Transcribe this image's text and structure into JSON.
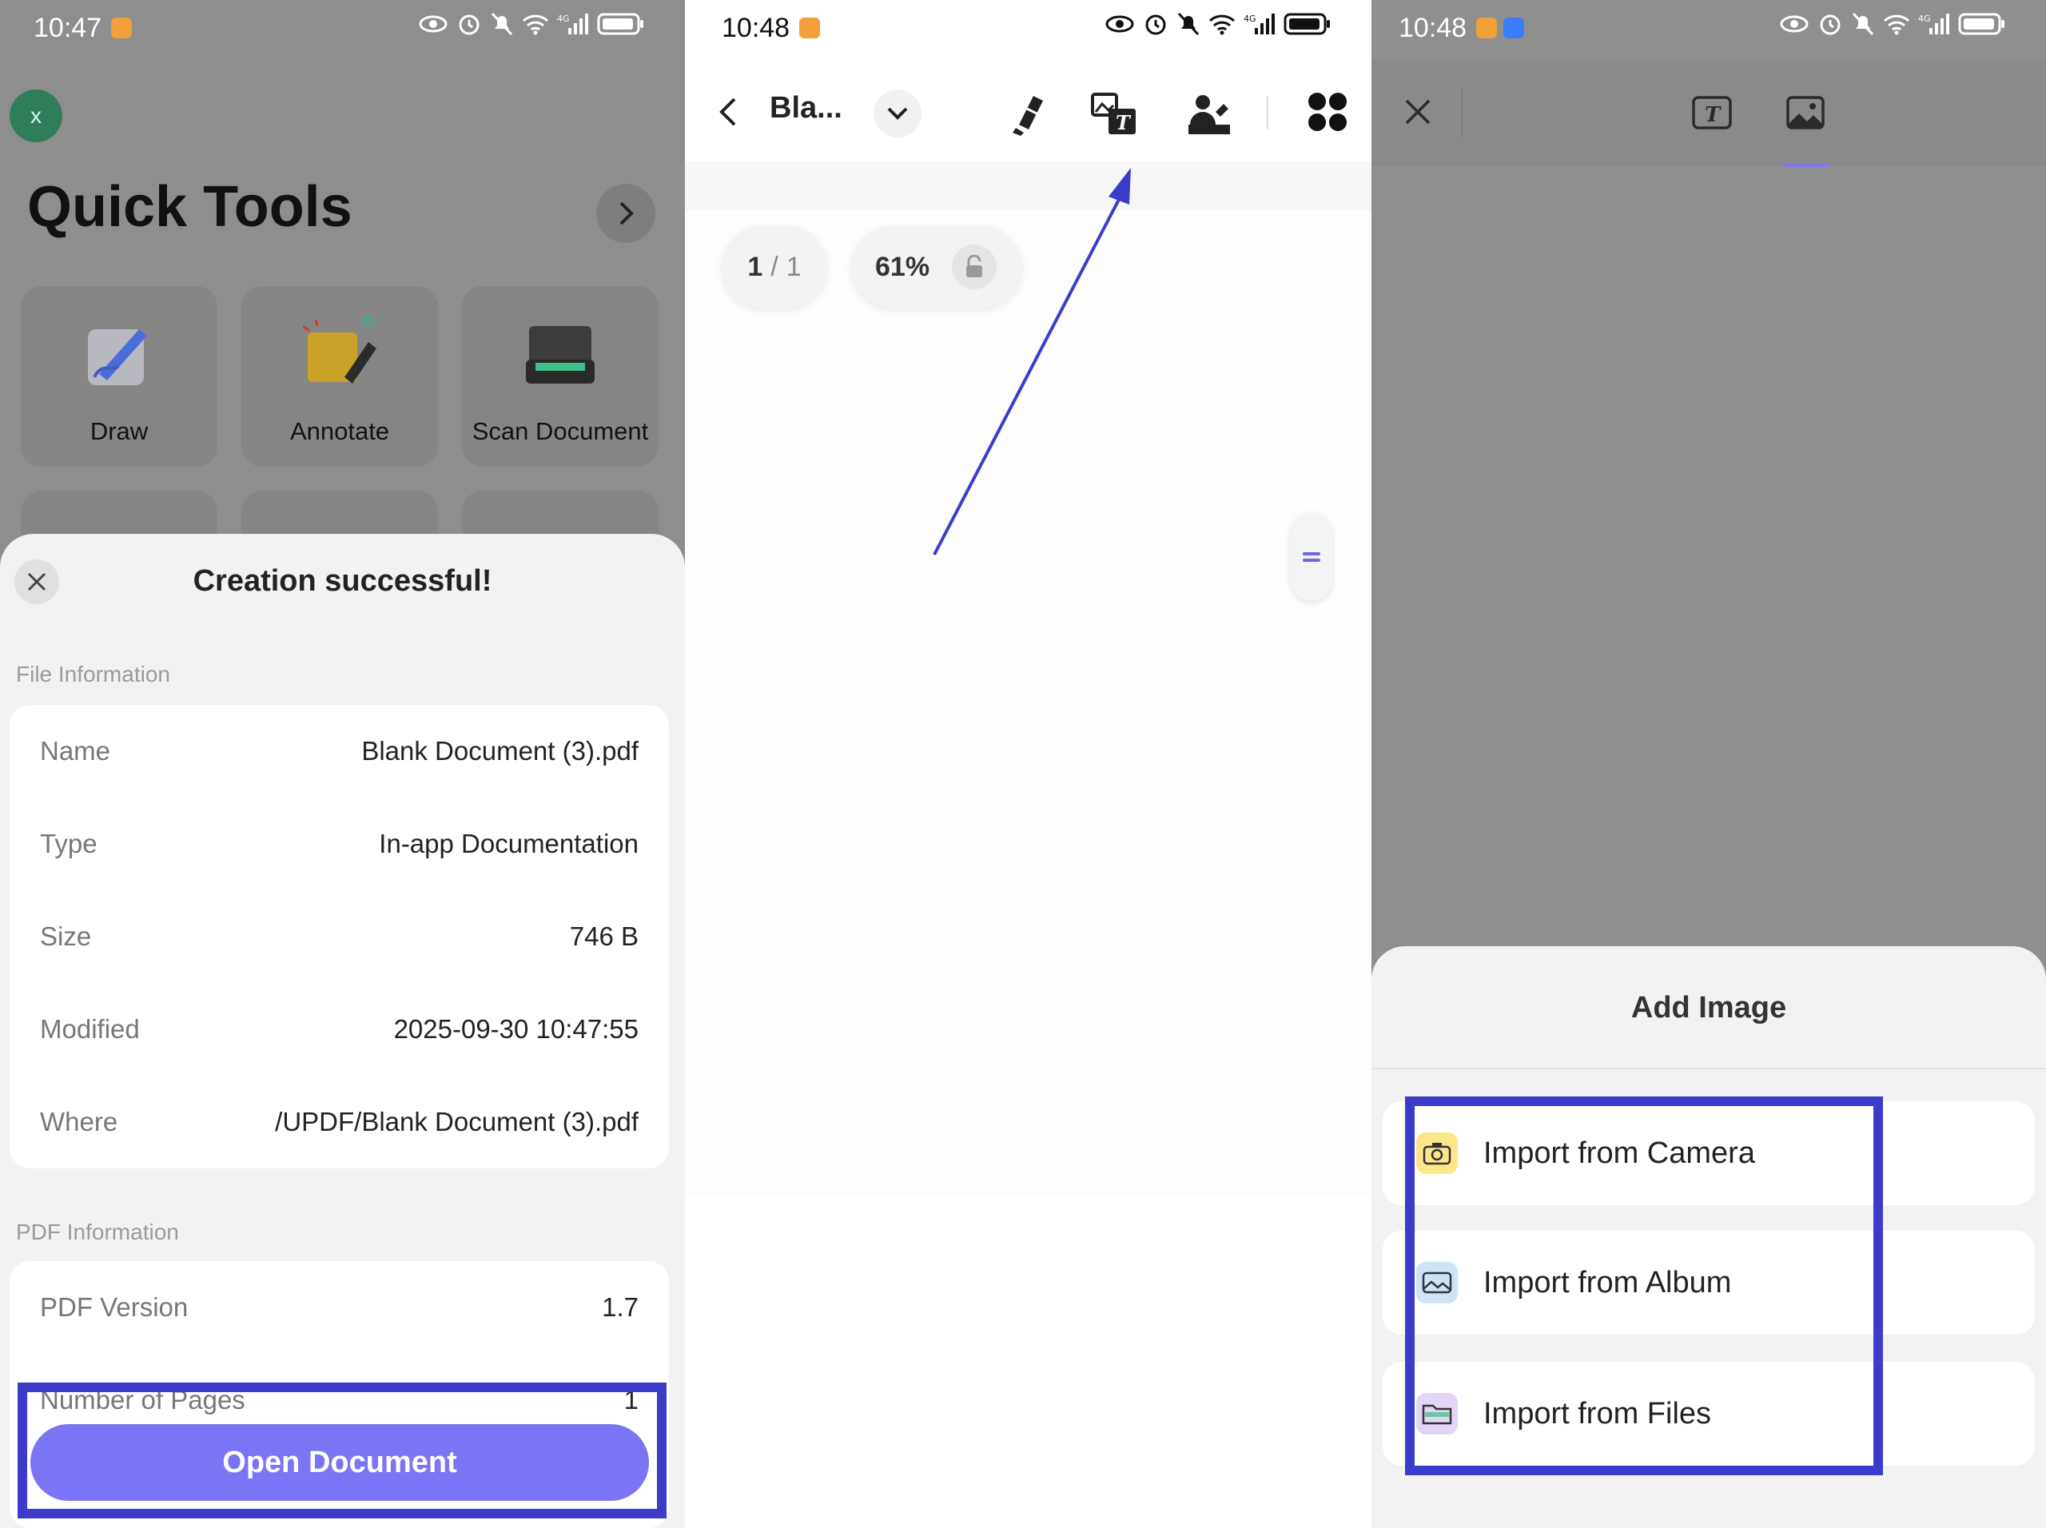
{
  "panel1": {
    "status_time": "10:47",
    "fab_label": "x",
    "title": "Quick Tools",
    "tools": [
      {
        "label": "Draw",
        "icon": "draw-pen-icon"
      },
      {
        "label": "Annotate",
        "icon": "annotate-note-icon"
      },
      {
        "label": "Scan Document",
        "icon": "scanner-icon"
      }
    ],
    "sheet": {
      "title": "Creation successful!",
      "file_section": "File Information",
      "rows": [
        {
          "key": "Name",
          "value": "Blank Document (3).pdf"
        },
        {
          "key": "Type",
          "value": "In-app Documentation"
        },
        {
          "key": "Size",
          "value": "746 B"
        },
        {
          "key": "Modified",
          "value": "2025-09-30 10:47:55"
        },
        {
          "key": "Where",
          "value": "/UPDF/Blank Document (3).pdf"
        }
      ],
      "pdf_section": "PDF Information",
      "pdf_rows": [
        {
          "key": "PDF Version",
          "value": "1.7"
        },
        {
          "key": "Number of Pages",
          "value": "1"
        }
      ],
      "open_button": "Open Document"
    },
    "highlight_color": "#3b3cc9"
  },
  "panel2": {
    "status_time": "10:48",
    "doc_name": "Bla...",
    "page_indicator": {
      "current": "1",
      "separator": "/",
      "total": "1"
    },
    "zoom": "61%",
    "toolbar_icons": [
      "highlighter-icon",
      "edit-text-image-icon",
      "fill-sign-icon",
      "grid-menu-icon"
    ],
    "arrow_color": "#3b3cc9"
  },
  "panel3": {
    "status_time": "10:48",
    "sheet_title": "Add Image",
    "options": [
      {
        "label": "Import from Camera",
        "icon": "camera-icon",
        "color": "#fde58a"
      },
      {
        "label": "Import from Album",
        "icon": "album-icon",
        "color": "#cde4f7"
      },
      {
        "label": "Import from Files",
        "icon": "folder-icon",
        "color": "#e3d6f5"
      }
    ],
    "accent": "#7e7ae6"
  }
}
